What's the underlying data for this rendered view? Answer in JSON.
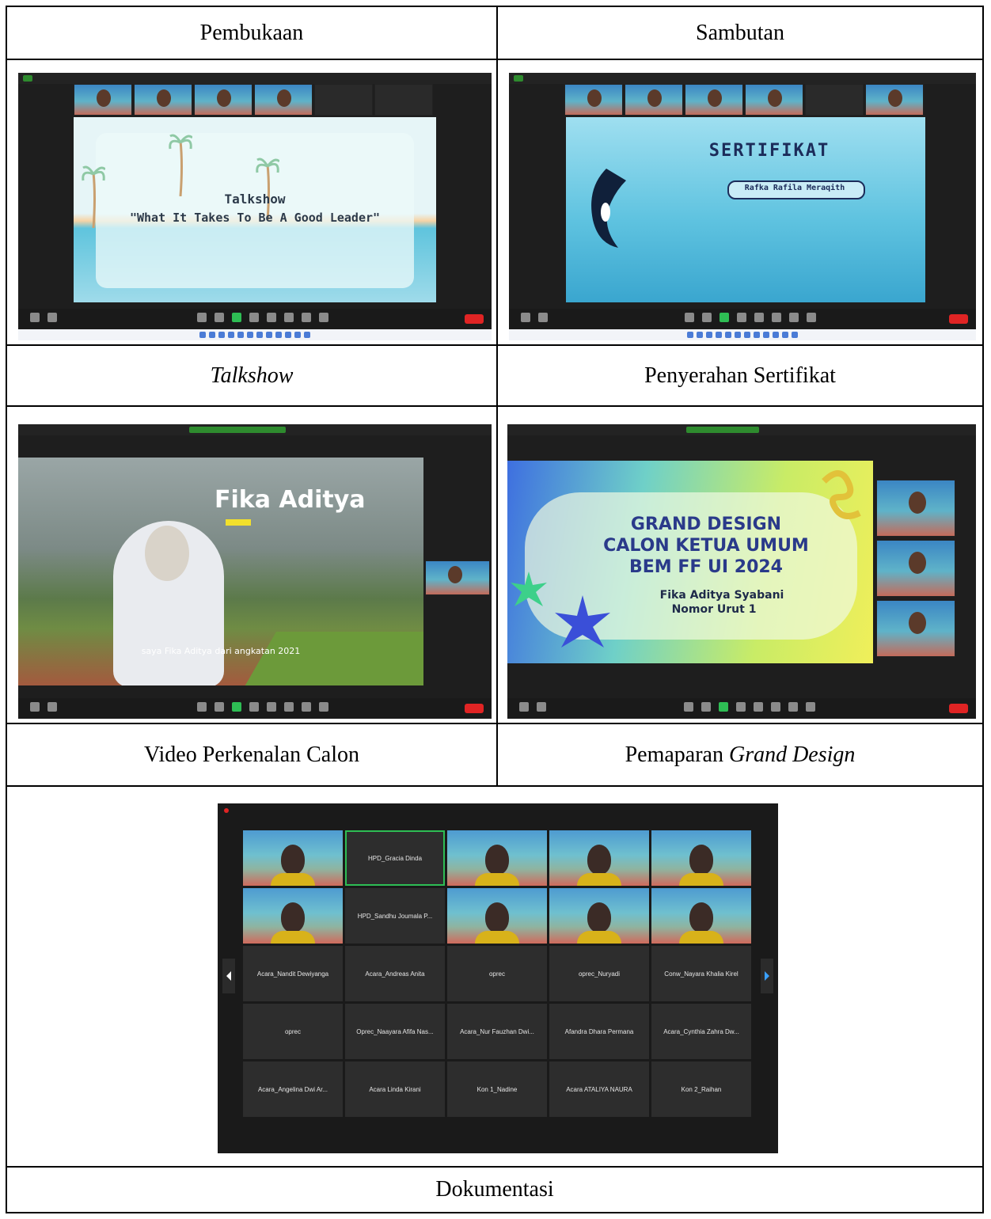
{
  "captions": {
    "pembukaan": "Pembukaan",
    "sambutan": "Sambutan",
    "talkshow": "Talkshow",
    "penyerahan": "Penyerahan Sertifikat",
    "video": "Video Perkenalan Calon",
    "pemaparan_prefix": "Pemaparan ",
    "pemaparan_italic": "Grand Design",
    "dokumentasi": "Dokumentasi"
  },
  "shot1": {
    "slide_title": "Talkshow",
    "slide_subtitle": "\"What It Takes To Be A Good Leader\""
  },
  "shot2": {
    "title": "SERTIFIKAT",
    "recipient": "Rafka Rafila Meraqith"
  },
  "shot3": {
    "name": "Fika Aditya",
    "subtitle": "saya Fika Aditya dari angkatan 2021"
  },
  "shot4": {
    "line1": "GRAND DESIGN",
    "line2": "CALON KETUA UMUM",
    "line3": "BEM FF UI 2024",
    "candidate": "Fika Aditya Syabani",
    "number": "Nomor Urut 1"
  },
  "gallery": {
    "tiles": [
      {
        "type": "video",
        "label": ""
      },
      {
        "type": "name",
        "label": "HPD_Gracia Dinda",
        "active": true
      },
      {
        "type": "video",
        "label": ""
      },
      {
        "type": "video",
        "label": ""
      },
      {
        "type": "video",
        "label": ""
      },
      {
        "type": "video",
        "label": ""
      },
      {
        "type": "name",
        "label": "HPD_Sandhu Joumala P..."
      },
      {
        "type": "video",
        "label": ""
      },
      {
        "type": "video",
        "label": ""
      },
      {
        "type": "video",
        "label": ""
      },
      {
        "type": "name",
        "label": "Acara_Nandit Dewiyanga"
      },
      {
        "type": "name",
        "label": "Acara_Andreas Anita"
      },
      {
        "type": "name",
        "label": "oprec"
      },
      {
        "type": "name",
        "label": "oprec_Nuryadi"
      },
      {
        "type": "name",
        "label": "Conw_Nayara Khalia Kirel"
      },
      {
        "type": "name",
        "label": "oprec"
      },
      {
        "type": "name",
        "label": "Oprec_Naayara Afifa Nas..."
      },
      {
        "type": "name",
        "label": "Acara_Nur Fauzhan Dwi..."
      },
      {
        "type": "name",
        "label": "Afandra Dhara Permana"
      },
      {
        "type": "name",
        "label": "Acara_Cynthia Zahra Dw..."
      },
      {
        "type": "name",
        "label": "Acara_Angelina Dwi Ar..."
      },
      {
        "type": "name",
        "label": "Acara Linda Kirani"
      },
      {
        "type": "name",
        "label": "Kon 1_Nadine"
      },
      {
        "type": "name",
        "label": "Acara ATALIYA NAURA"
      },
      {
        "type": "name",
        "label": "Kon 2_Raihan"
      }
    ]
  },
  "colors": {
    "border": "#000000",
    "zoom_bg": "#1e1e1e",
    "active_green": "#2ebd54",
    "leave_red": "#e02424"
  }
}
